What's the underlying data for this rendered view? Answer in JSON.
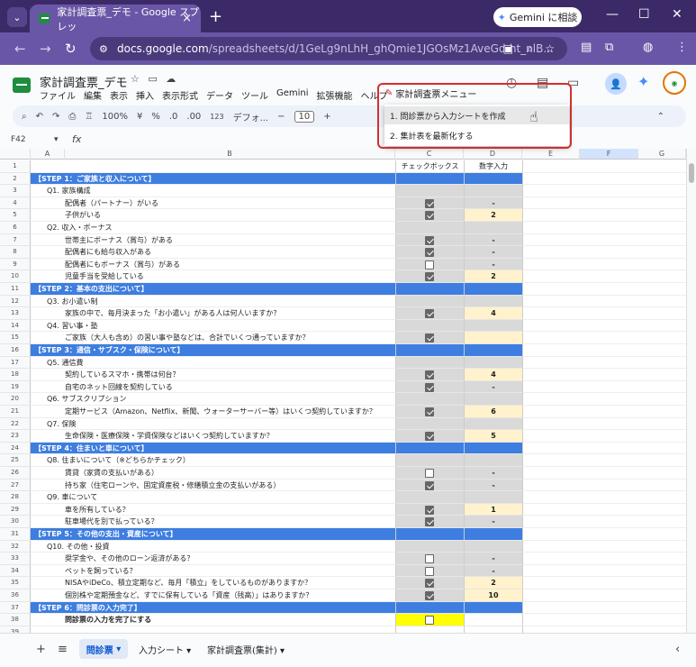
{
  "browser": {
    "tab_title": "家計調査票_デモ - Google スプレッ",
    "tab_close": "×",
    "new_tab": "+",
    "gemini_button": "Gemini に相談",
    "minimize": "—",
    "maximize": "☐",
    "close": "✕",
    "url_host": "docs.google.com",
    "url_rest": "/spreadsheets/d/1GeLg9nLhH_ghQmie1JGOsMz1AveGd-ht_nlB..."
  },
  "sheets": {
    "doc_title": "家計調査票_デモ",
    "menu": [
      "ファイル",
      "編集",
      "表示",
      "挿入",
      "表示形式",
      "データ",
      "ツール",
      "Gemini",
      "拡張機能",
      "ヘルプ"
    ],
    "custom_menu": "家計調査票メニュー",
    "zoom": "100%",
    "currency": "¥",
    "percent": "%",
    "dec_less": ".0",
    "dec_more": ".00",
    "num_fmt": "123",
    "font": "デフォ...",
    "minus": "−",
    "font_size": "10",
    "plus": "+",
    "cell_ref": "F42",
    "fx": "fx",
    "dropdown_items": [
      "1. 問診票から入力シートを作成",
      "2. 集計表を最新化する"
    ]
  },
  "columns": [
    "A",
    "B",
    "C",
    "D",
    "E",
    "F",
    "G"
  ],
  "rows": [
    {
      "n": "1",
      "type": "hdr",
      "a": "",
      "c": "チェックボックス",
      "d": "数字入力"
    },
    {
      "n": "2",
      "type": "step",
      "a": "【STEP 1：ご家族と収入について】"
    },
    {
      "n": "3",
      "type": "q",
      "a": "Q1. 家族構成"
    },
    {
      "n": "4",
      "type": "item",
      "a": "配偶者（パートナー）がいる",
      "cb": true,
      "d": "-"
    },
    {
      "n": "5",
      "type": "item",
      "a": "子供がいる",
      "cb": true,
      "d": "2",
      "num": true
    },
    {
      "n": "6",
      "type": "q",
      "a": "Q2. 収入・ボーナス"
    },
    {
      "n": "7",
      "type": "item",
      "a": "世帯主にボーナス（賞与）がある",
      "cb": true,
      "d": "-"
    },
    {
      "n": "8",
      "type": "item",
      "a": "配偶者にも給与収入がある",
      "cb": true,
      "d": "-"
    },
    {
      "n": "9",
      "type": "item",
      "a": "配偶者にもボーナス（賞与）がある",
      "cb": false,
      "d": "-"
    },
    {
      "n": "10",
      "type": "item",
      "a": "児童手当を受給している",
      "cb": true,
      "d": "2",
      "num": true
    },
    {
      "n": "11",
      "type": "step",
      "a": "【STEP 2：基本の支出について】"
    },
    {
      "n": "12",
      "type": "q",
      "a": "Q3. お小遣い制"
    },
    {
      "n": "13",
      "type": "item",
      "a": "家族の中で、毎月決まった「お小遣い」がある人は何人いますか？",
      "cb": true,
      "d": "4",
      "num": true
    },
    {
      "n": "14",
      "type": "q",
      "a": "Q4. 習い事・塾"
    },
    {
      "n": "15",
      "type": "item",
      "a": "ご家族（大人も含め）の習い事や塾などは、合計でいくつ通っていますか？",
      "cb": true,
      "d": "",
      "num": true
    },
    {
      "n": "16",
      "type": "step",
      "a": "【STEP 3：通信・サブスク・保険について】"
    },
    {
      "n": "17",
      "type": "q",
      "a": "Q5. 通信費"
    },
    {
      "n": "18",
      "type": "item",
      "a": "契約しているスマホ・携帯は何台？",
      "cb": true,
      "d": "4",
      "num": true
    },
    {
      "n": "19",
      "type": "item",
      "a": "自宅のネット回線を契約している",
      "cb": true,
      "d": "-"
    },
    {
      "n": "20",
      "type": "q",
      "a": "Q6. サブスクリプション"
    },
    {
      "n": "21",
      "type": "item",
      "a": "定期サービス（Amazon、Netflix、新聞、ウォーターサーバー等）はいくつ契約していますか？",
      "cb": true,
      "d": "6",
      "num": true
    },
    {
      "n": "22",
      "type": "q",
      "a": "Q7. 保険"
    },
    {
      "n": "23",
      "type": "item",
      "a": "生命保険・医療保険・学資保険などはいくつ契約していますか？",
      "cb": true,
      "d": "5",
      "num": true
    },
    {
      "n": "24",
      "type": "step",
      "a": "【STEP 4：住まいと車について】"
    },
    {
      "n": "25",
      "type": "q",
      "a": "Q8. 住まいについて（※どちらかチェック）"
    },
    {
      "n": "26",
      "type": "item",
      "a": "賃貸（家賃の支払いがある）",
      "cb": false,
      "d": "-"
    },
    {
      "n": "27",
      "type": "item",
      "a": "持ち家（住宅ローンや、固定資産税・修繕積立金の支払いがある）",
      "cb": true,
      "d": "-"
    },
    {
      "n": "28",
      "type": "q",
      "a": "Q9. 車について"
    },
    {
      "n": "29",
      "type": "item",
      "a": "車を所有している？",
      "cb": true,
      "d": "1",
      "num": true
    },
    {
      "n": "30",
      "type": "item",
      "a": "駐車場代を別で払っている？",
      "cb": true,
      "d": "-"
    },
    {
      "n": "31",
      "type": "step",
      "a": "【STEP 5：その他の支出・資産について】"
    },
    {
      "n": "32",
      "type": "q",
      "a": "Q10. その他・投資"
    },
    {
      "n": "33",
      "type": "item",
      "a": "奨学金や、その他のローン返済がある？",
      "cb": false,
      "d": "-"
    },
    {
      "n": "34",
      "type": "item",
      "a": "ペットを飼っている？",
      "cb": false,
      "d": "-"
    },
    {
      "n": "35",
      "type": "item",
      "a": "NISAやiDeCo、積立定期など、毎月「積立」をしているものがありますか？",
      "cb": true,
      "d": "2",
      "num": true
    },
    {
      "n": "36",
      "type": "item",
      "a": "個別株や定期預金など、すでに保有している「資産（残高）」はありますか？",
      "cb": true,
      "d": "10",
      "num": true
    },
    {
      "n": "37",
      "type": "step",
      "a": "【STEP 6：問診票の入力完了】"
    },
    {
      "n": "38",
      "type": "final",
      "a": "問診票の入力を完了にする",
      "cb": false,
      "d": ""
    },
    {
      "n": "39",
      "type": "blank",
      "a": ""
    }
  ],
  "sheet_tabs": [
    "問診票",
    "入力シート",
    "家計調査票(集計)"
  ],
  "sheet_add": "+",
  "sheet_list": "≡",
  "sheet_prev": "‹"
}
